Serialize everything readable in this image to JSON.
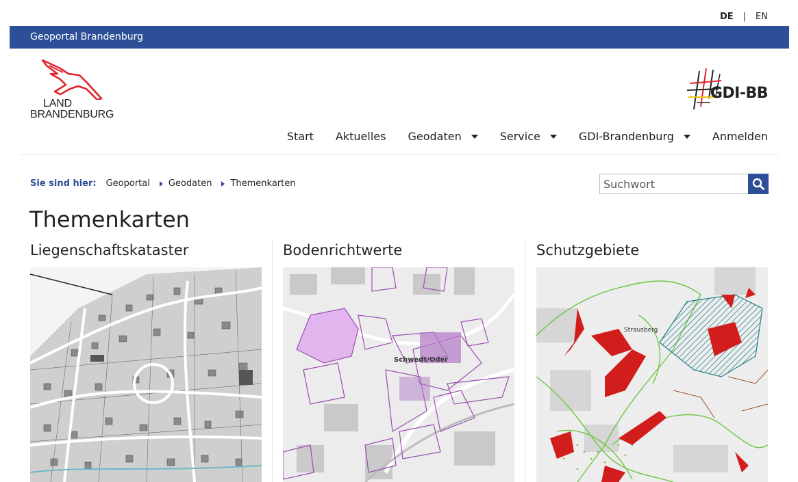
{
  "language": {
    "de": "DE",
    "en": "EN",
    "active": "DE"
  },
  "topbar": {
    "title": "Geoportal Brandenburg"
  },
  "logos": {
    "land": {
      "line1": "LAND",
      "line2": "BRANDENBURG",
      "color": "#e3232b"
    },
    "gdi": {
      "text": "GDI-BB"
    }
  },
  "nav": {
    "items": [
      {
        "label": "Start",
        "dropdown": false
      },
      {
        "label": "Aktuelles",
        "dropdown": false
      },
      {
        "label": "Geodaten",
        "dropdown": true
      },
      {
        "label": "Service",
        "dropdown": true
      },
      {
        "label": "GDI-Brandenburg",
        "dropdown": true
      },
      {
        "label": "Anmelden",
        "dropdown": false
      }
    ]
  },
  "breadcrumb": {
    "label": "Sie sind hier:",
    "items": [
      "Geoportal",
      "Geodaten",
      "Themenkarten"
    ]
  },
  "search": {
    "placeholder": "Suchwort",
    "icon": "search-icon"
  },
  "page": {
    "title": "Themenkarten"
  },
  "cards": [
    {
      "title": "Liegenschaftskataster",
      "image": "cadastre-map-thumbnail"
    },
    {
      "title": "Bodenrichtwerte",
      "image": "land-value-map-thumbnail",
      "label": "Schwedt/Oder"
    },
    {
      "title": "Schutzgebiete",
      "image": "protected-areas-map-thumbnail",
      "label": "Strausberg"
    }
  ],
  "colors": {
    "brand_blue": "#2d4f98",
    "land_red": "#e3232b",
    "purple": "#9b4fb0",
    "protect_green": "#6cc644",
    "protect_red": "#d21d1d",
    "teal": "#1e7f86"
  }
}
